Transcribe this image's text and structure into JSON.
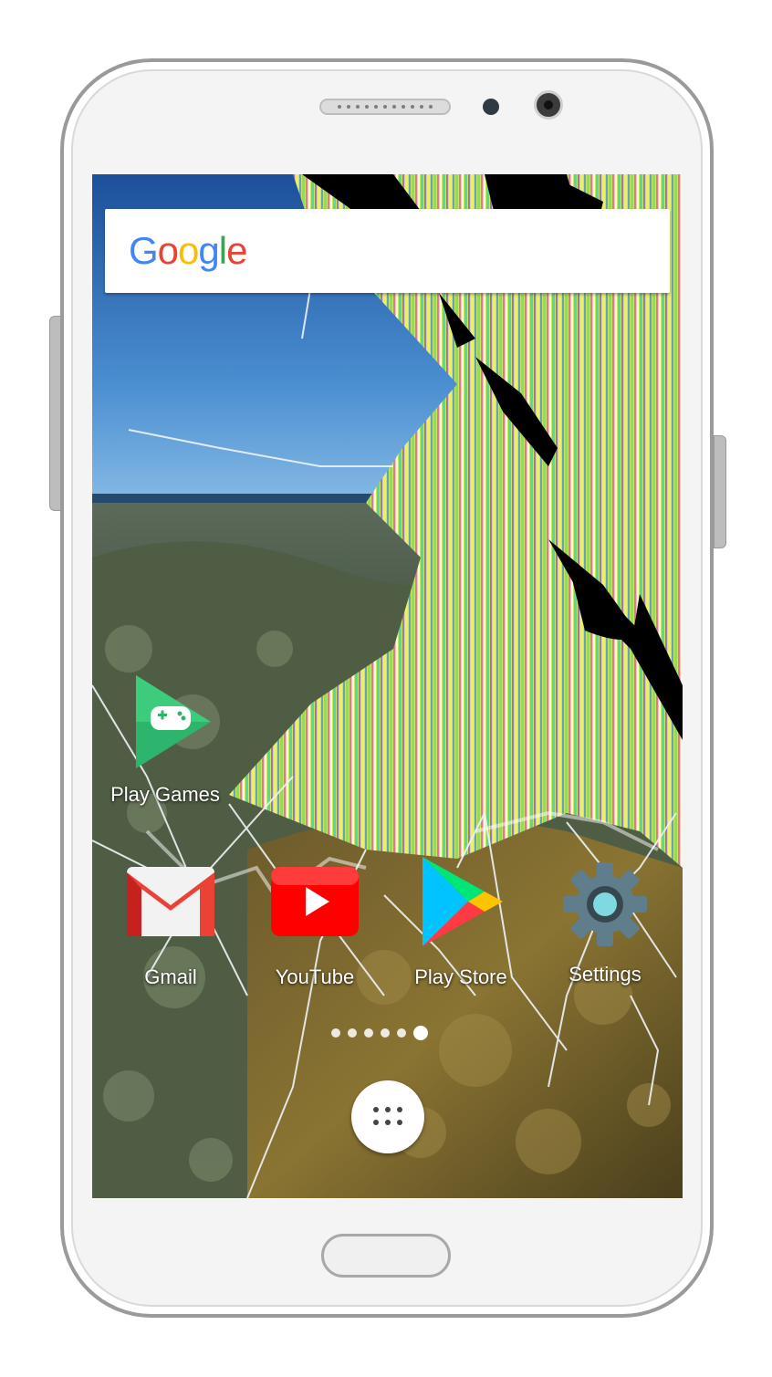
{
  "search": {
    "logo_text": [
      "G",
      "o",
      "o",
      "g",
      "l",
      "e"
    ]
  },
  "apps": [
    {
      "id": "play-games",
      "label": "Play Games",
      "icon": "play-games-icon"
    },
    {
      "id": "gmail",
      "label": "Gmail",
      "icon": "gmail-icon"
    },
    {
      "id": "youtube",
      "label": "YouTube",
      "icon": "youtube-icon"
    },
    {
      "id": "play-store",
      "label": "Play Store",
      "icon": "play-store-icon"
    },
    {
      "id": "settings",
      "label": "Settings",
      "icon": "settings-icon"
    }
  ],
  "page_indicator": {
    "count": 6,
    "active_index": 5
  },
  "colors": {
    "google_blue": "#4285F4",
    "google_red": "#EA4335",
    "google_yellow": "#FBBC05",
    "google_green": "#34A853",
    "youtube_red": "#FF0000",
    "play_games_green": "#2DB56B",
    "settings_grey": "#607D8B"
  }
}
